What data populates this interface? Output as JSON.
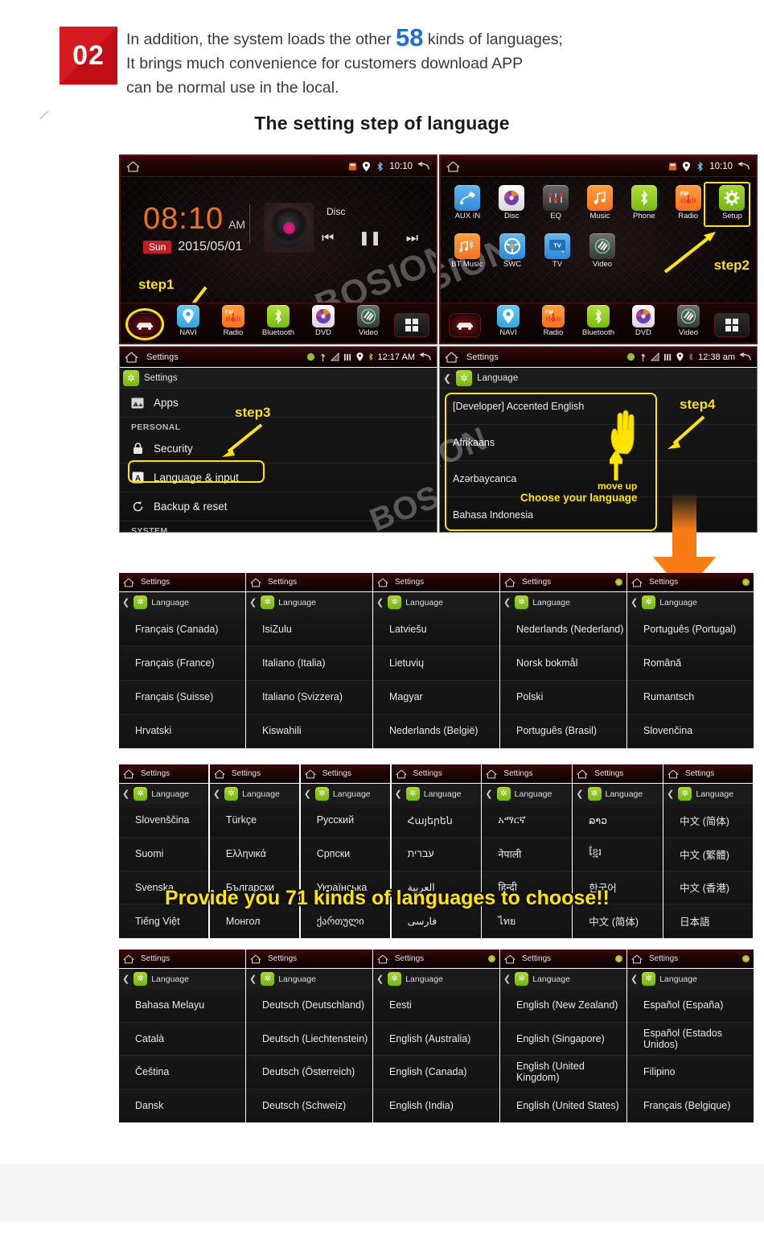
{
  "header": {
    "badge": "02",
    "line1_pre": "In addition, the system loads the other ",
    "line1_num": "58",
    "line1_post": " kinds of languages;",
    "line2": "It brings much convenience for customers download APP",
    "line3": "can be normal use in the local.",
    "subtitle": "The setting step of language",
    "accent_blue": "#1f6fd0",
    "badge_red": "#d51b22",
    "highlight_yellow": "#ffe400"
  },
  "screen1": {
    "status": {
      "title": "",
      "time": "10:10",
      "icons": [
        "sd-card-icon",
        "location-icon",
        "bluetooth-icon"
      ]
    },
    "clock": {
      "time": "08:10",
      "ampm": "AM",
      "day": "Sun",
      "date": "2015/05/01"
    },
    "media": {
      "source": "Disc",
      "prev": "⏮",
      "pause": "❚❚",
      "next": "⏭"
    },
    "dock": [
      {
        "label": "NAVI",
        "icon": "navi-icon"
      },
      {
        "label": "Radio",
        "icon": "radio-icon"
      },
      {
        "label": "Bluetooth",
        "icon": "bluetooth-icon"
      },
      {
        "label": "DVD",
        "icon": "dvd-icon"
      },
      {
        "label": "Video",
        "icon": "video-icon"
      }
    ],
    "step_label": "step1",
    "watermark": "BOSION"
  },
  "screen2": {
    "status": {
      "time": "10:10"
    },
    "apps_row1": [
      {
        "label": "AUX IN",
        "icon": "aux-in-icon"
      },
      {
        "label": "Disc",
        "icon": "disc-icon"
      },
      {
        "label": "EQ",
        "icon": "equalizer-icon"
      },
      {
        "label": "Music",
        "icon": "music-icon"
      },
      {
        "label": "Phone",
        "icon": "phone-icon"
      },
      {
        "label": "Radio",
        "icon": "radio-icon"
      },
      {
        "label": "Setup",
        "icon": "setup-gear-icon"
      }
    ],
    "apps_row2": [
      {
        "label": "BT Music",
        "icon": "bt-music-icon"
      },
      {
        "label": "SWC",
        "icon": "swc-icon"
      },
      {
        "label": "TV",
        "icon": "tv-icon"
      },
      {
        "label": "Video",
        "icon": "video-icon"
      }
    ],
    "dock": [
      {
        "label": "NAVI",
        "icon": "navi-icon"
      },
      {
        "label": "Radio",
        "icon": "radio-icon"
      },
      {
        "label": "Bluetooth",
        "icon": "bluetooth-icon"
      },
      {
        "label": "DVD",
        "icon": "dvd-icon"
      },
      {
        "label": "Video",
        "icon": "video-icon"
      }
    ],
    "step_label": "step2",
    "watermark": "SION"
  },
  "screen3": {
    "status": {
      "title": "Settings",
      "time": "12:17 AM"
    },
    "crumb": "Settings",
    "rows": [
      {
        "label": "Apps",
        "icon": "apps-icon"
      },
      {
        "label": "Security",
        "icon": "lock-icon"
      },
      {
        "label": "Language & input",
        "icon": "language-a-icon"
      },
      {
        "label": "Backup & reset",
        "icon": "backup-reset-icon"
      }
    ],
    "section_personal": "PERSONAL",
    "section_system": "SYSTEM",
    "step_label": "step3",
    "watermark": "BOS"
  },
  "screen4": {
    "status": {
      "title": "Settings",
      "time": "12:38 am"
    },
    "crumb": "Language",
    "items": [
      "[Developer] Accented English",
      "Afrikaans",
      "Azərbaycanca",
      "Bahasa Indonesia"
    ],
    "step_label": "step4",
    "annot_move_up": "move up",
    "annot_choose": "Choose your language",
    "watermark": "ION"
  },
  "banner": {
    "text": "Provide you 71 kinds of languages to choose!!"
  },
  "panel_common": {
    "status_title": "Settings",
    "crumb": "Language"
  },
  "rows": [
    {
      "panels": [
        {
          "items": [
            "Français (Canada)",
            "Français (France)",
            "Français (Suisse)",
            "Hrvatski"
          ]
        },
        {
          "items": [
            "IsiZulu",
            "Italiano (Italia)",
            "Italiano (Svizzera)",
            "Kiswahili"
          ]
        },
        {
          "items": [
            "Latviešu",
            "Lietuvių",
            "Magyar",
            "Nederlands (België)"
          ]
        },
        {
          "items": [
            "Nederlands (Nederland)",
            "Norsk bokmål",
            "Polski",
            "Português (Brasil)"
          ]
        },
        {
          "items": [
            "Português (Portugal)",
            "Română",
            "Rumantsch",
            "Slovenčina"
          ]
        }
      ]
    },
    {
      "panels": [
        {
          "items": [
            "Slovenščina",
            "Suomi",
            "Svenska",
            "Tiếng Việt"
          ]
        },
        {
          "items": [
            "Türkçe",
            "Ελληνικά",
            "Български",
            "Монгол"
          ]
        },
        {
          "items": [
            "Русский",
            "Српски",
            "Українська",
            "ქართული"
          ]
        },
        {
          "items": [
            "Հայերեն",
            "עברית",
            "العربية",
            "فارسى"
          ]
        },
        {
          "items": [
            "አማርኛ",
            "नेपाली",
            "हिन्दी",
            "ไทย"
          ]
        },
        {
          "items": [
            "ລາວ",
            "ខ្មែរ",
            "한국어",
            "中文 (简体)"
          ]
        },
        {
          "items": [
            "中文 (简体)",
            "中文 (繁體)",
            "中文 (香港)",
            "日本語"
          ]
        }
      ]
    },
    {
      "panels": [
        {
          "items": [
            "Bahasa Melayu",
            "Català",
            "Čeština",
            "Dansk"
          ]
        },
        {
          "items": [
            "Deutsch (Deutschland)",
            "Deutsch (Liechtenstein)",
            "Deutsch (Österreich)",
            "Deutsch (Schweiz)"
          ]
        },
        {
          "items": [
            "Eesti",
            "English (Australia)",
            "English (Canada)",
            "English (India)"
          ]
        },
        {
          "items": [
            "English (New Zealand)",
            "English (Singapore)",
            "English (United Kingdom)",
            "English (United States)"
          ]
        },
        {
          "items": [
            "Español (España)",
            "Español (Estados Unidos)",
            "Filipino",
            "Français (Belgique)"
          ]
        }
      ]
    }
  ]
}
